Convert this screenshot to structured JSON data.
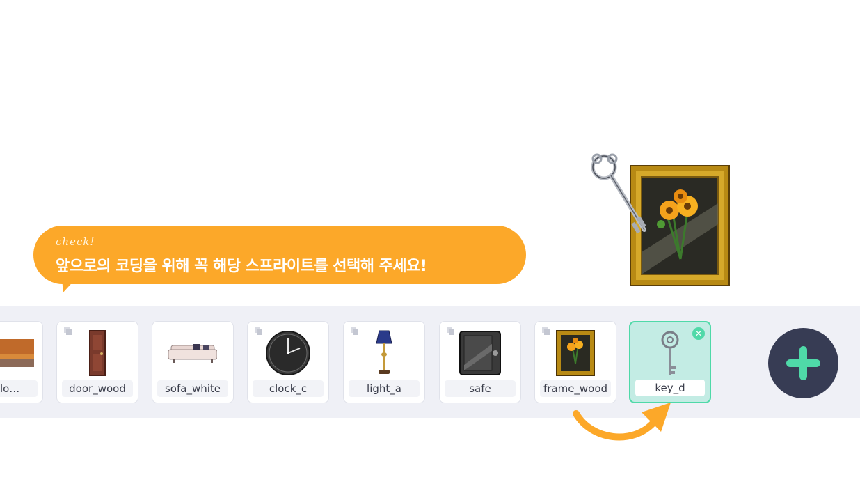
{
  "bubble": {
    "check": "check!",
    "message": "앞으로의 코딩을 위해 꼭 해당 스프라이트를 선택해 주세요!"
  },
  "sprites": [
    {
      "name": "yello…",
      "icon": "background-yellow-room-icon"
    },
    {
      "name": "door_wood",
      "icon": "door-icon"
    },
    {
      "name": "sofa_white",
      "icon": "sofa-icon"
    },
    {
      "name": "clock_c",
      "icon": "clock-icon"
    },
    {
      "name": "light_a",
      "icon": "lamp-icon"
    },
    {
      "name": "safe",
      "icon": "safe-icon"
    },
    {
      "name": "frame_wood",
      "icon": "picture-frame-icon"
    },
    {
      "name": "key_d",
      "icon": "key-icon",
      "selected": true
    }
  ],
  "colors": {
    "bubble": "#fca829",
    "selected_bg": "#c3ece4",
    "selected_border": "#4fd9a8",
    "add_button": "#373c54",
    "add_plus": "#4fd9a8",
    "arrow": "#fca829"
  }
}
